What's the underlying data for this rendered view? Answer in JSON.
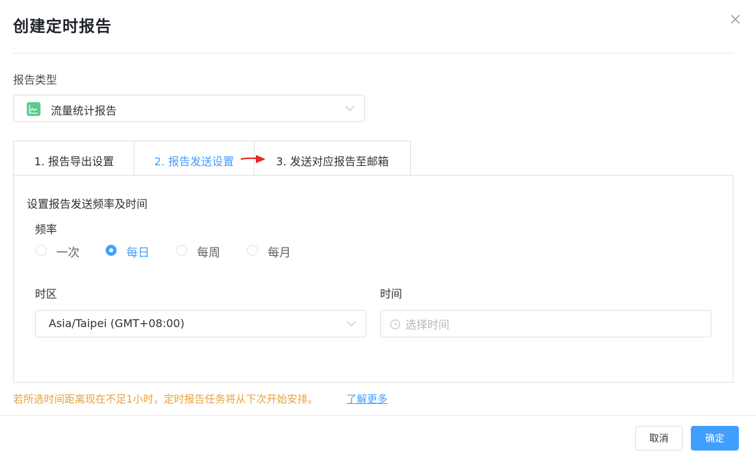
{
  "dialog": {
    "title": "创建定时报告"
  },
  "report_type": {
    "label": "报告类型",
    "selected": "流量统计报告"
  },
  "tabs": [
    {
      "label": "1. 报告导出设置",
      "active": false
    },
    {
      "label": "2. 报告发送设置",
      "active": true
    },
    {
      "label": "3. 发送对应报告至邮箱",
      "active": false
    }
  ],
  "send_settings": {
    "section_title": "设置报告发送频率及时间",
    "frequency_label": "频率",
    "frequency_options": [
      {
        "label": "一次",
        "checked": false
      },
      {
        "label": "每日",
        "checked": true
      },
      {
        "label": "每周",
        "checked": false
      },
      {
        "label": "每月",
        "checked": false
      }
    ],
    "timezone_label": "时区",
    "timezone_value": "Asia/Taipei (GMT+08:00)",
    "time_label": "时间",
    "time_placeholder": "选择时间"
  },
  "notice": {
    "text": "若所选时间距离现在不足1小时，定时报告任务将从下次开始安排。",
    "link": "了解更多"
  },
  "footer": {
    "cancel_label": "取消",
    "confirm_label": "确定"
  },
  "colors": {
    "accent": "#409eff",
    "warning": "#e6a23c",
    "arrow": "#e6261f",
    "report_icon": "#5ccb8e"
  }
}
